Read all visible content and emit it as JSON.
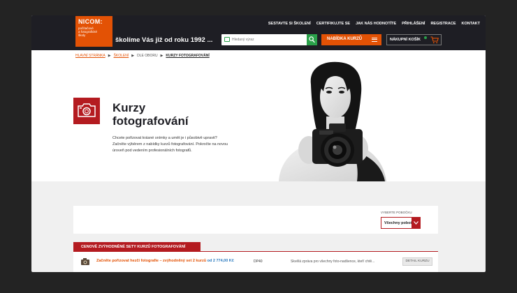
{
  "header": {
    "logo": {
      "name": "NICOM:",
      "sub": "počítačové\na fotografické\nškoly"
    },
    "slogan": "školíme Vás již od roku 1992 ...",
    "nav": [
      "SESTAVTE SI ŠKOLENÍ",
      "CERTIFIKUJTE SE",
      "JAK NÁS HODNOTÍTE",
      "PŘIHLÁŠENÍ",
      "REGISTRACE",
      "KONTAKT"
    ],
    "search_placeholder": "Hledaný výraz",
    "offer_label": "NABÍDKA KURZŮ",
    "cart_label": "NÁKUPNÍ KOŠÍK",
    "colors": {
      "accent": "#e35205",
      "green": "#2aa14a",
      "red": "#b41b20",
      "dark": "#1e1e24"
    }
  },
  "breadcrumb": {
    "home": "HLAVNÍ STRÁNKA",
    "trainings": "ŠKOLENÍ",
    "by_field": "DLE OBORU",
    "current": "KURZY FOTOGRAFOVÁNÍ"
  },
  "hero": {
    "title": "Kurzy fotografování",
    "text": "Chcete pořizovat krásné snímky a umět je i působivě upravit? Začněte výběrem z nabídky kurzů fotografování. Pokročte na novou úroveň pod vedením profesionálních fotografů."
  },
  "filter": {
    "label": "VYBERTE POBOČKU",
    "selected": "Všechny pobočky"
  },
  "table": {
    "tab_label": "CENOVĚ ZVÝHODNĚNÉ SETY KURZŮ FOTOGRAFOVÁNÍ",
    "rows": [
      {
        "title": "Začněte pořizovat hezčí fotografie – zvýhodněný set 2 kurzů",
        "price": "od 2 774,00 Kč",
        "code": "DP40",
        "desc": "Skvělá zpráva pro všechny foto-nadšence, kteří chtě...",
        "button": "DETAIL KURZU"
      }
    ]
  }
}
